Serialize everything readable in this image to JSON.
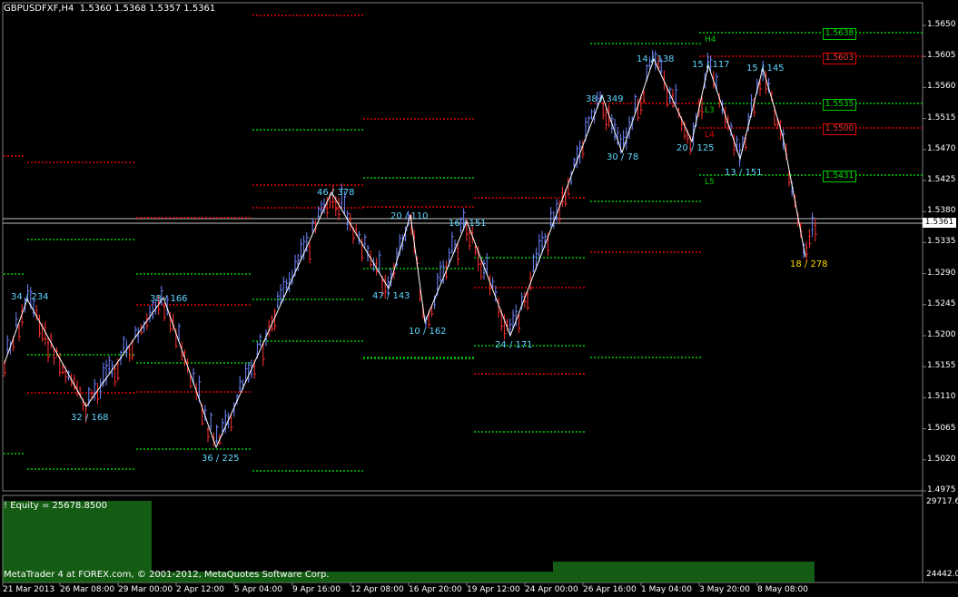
{
  "header": {
    "symbol": "GBPUSDFXF,H4",
    "ohlc": "1.5360 1.5368 1.5357 1.5361"
  },
  "equity_label": "! Equity = 25678.8500",
  "copyright": "MetaTrader 4 at FOREX.com, © 2001-2012, MetaQuotes Software Corp.",
  "current_price": "1.5361",
  "price_axis": [
    "1.5650",
    "1.5605",
    "1.5560",
    "1.5515",
    "1.5470",
    "1.5425",
    "1.5380",
    "1.5335",
    "1.5290",
    "1.5245",
    "1.5200",
    "1.5155",
    "1.5110",
    "1.5065",
    "1.5020",
    "1.4975"
  ],
  "equity_axis": [
    "29717.6",
    "24442.0"
  ],
  "time_axis": [
    "21 Mar 2013",
    "26 Mar 08:00",
    "29 Mar 00:00",
    "2 Apr 12:00",
    "5 Apr 04:00",
    "9 Apr 16:00",
    "12 Apr 08:00",
    "16 Apr 20:00",
    "19 Apr 12:00",
    "24 Apr 00:00",
    "26 Apr 16:00",
    "1 May 04:00",
    "3 May 20:00",
    "8 May 08:00"
  ],
  "levels": [
    {
      "name": "H4",
      "value": "1.5638",
      "color": "#00cc00"
    },
    {
      "name": "",
      "value": "1.5603",
      "color": "#e00000"
    },
    {
      "name": "L3",
      "value": "1.5535",
      "color": "#00cc00"
    },
    {
      "name": "L4",
      "value": "1.5500",
      "color": "#e00000"
    },
    {
      "name": "L5",
      "value": "1.5431",
      "color": "#00cc00"
    }
  ],
  "zigzag_labels": [
    "34 / 234",
    "32 / 168",
    "38 / 166",
    "36 / 225",
    "46 / 378",
    "47 / 143",
    "20 / 110",
    "10 / 162",
    "16 / 151",
    "24 / 171",
    "38 / 349",
    "30 / 78",
    "14 / 138",
    "20 / 125",
    "15 / 117",
    "13 / 151",
    "15 / 145",
    "18 / 278"
  ],
  "colors": {
    "background": "#000000",
    "bull": "#6f86ff",
    "bear": "#ff3030",
    "zigzag": "#ffffff",
    "label": "#5fd6ff",
    "last_label": "#ffd700",
    "equity": "#1a7a1a"
  }
}
